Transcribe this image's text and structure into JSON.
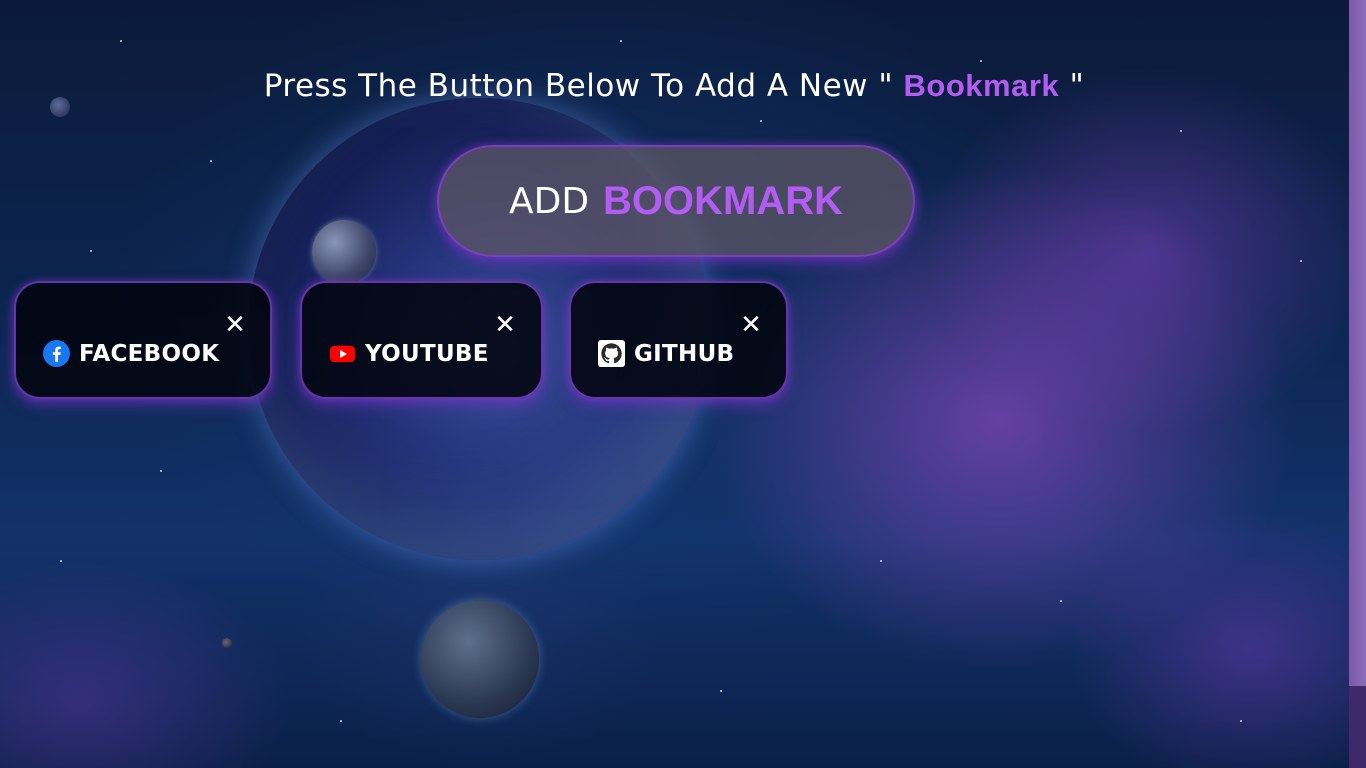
{
  "headline": {
    "prefix": "Press The Button Below To Add A New \" ",
    "accent": "Bookmark",
    "suffix": " \""
  },
  "add_button": {
    "word1": "ADD",
    "word2": "BOOKMARK"
  },
  "bookmarks": [
    {
      "label": "FACEBOOK",
      "icon": "facebook-icon",
      "close": "✕"
    },
    {
      "label": "YOUTUBE",
      "icon": "youtube-icon",
      "close": "✕"
    },
    {
      "label": "GITHUB",
      "icon": "github-icon",
      "close": "✕"
    }
  ],
  "colors": {
    "accent": "#b35cf2",
    "card_border": "#7a3cc8",
    "text": "#ffffff"
  }
}
